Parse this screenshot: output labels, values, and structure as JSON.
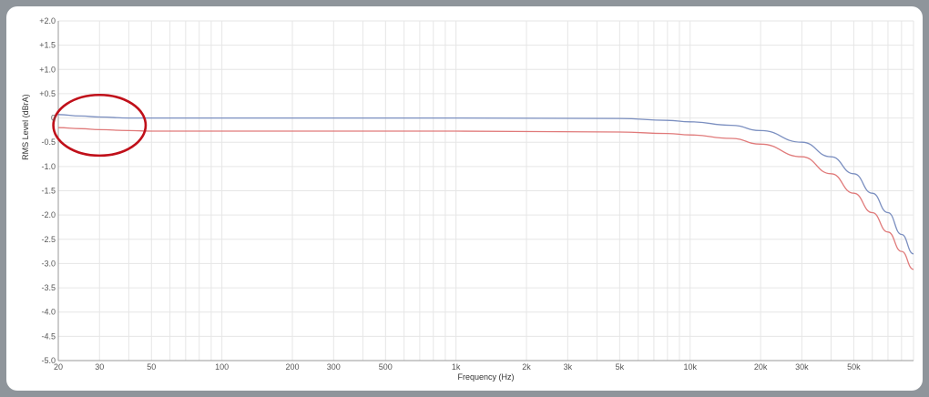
{
  "chart_data": {
    "type": "line",
    "title": "",
    "xlabel": "Frequency (Hz)",
    "ylabel": "RMS Level (dBrA)",
    "x_scale": "log",
    "xlim": [
      20,
      90000
    ],
    "ylim": [
      -5.0,
      2.0
    ],
    "grid": true,
    "legend": "none",
    "x_ticks": [
      {
        "value": 20,
        "label": "20"
      },
      {
        "value": 30,
        "label": "30"
      },
      {
        "value": 50,
        "label": "50"
      },
      {
        "value": 100,
        "label": "100"
      },
      {
        "value": 200,
        "label": "200"
      },
      {
        "value": 300,
        "label": "300"
      },
      {
        "value": 500,
        "label": "500"
      },
      {
        "value": 1000,
        "label": "1k"
      },
      {
        "value": 2000,
        "label": "2k"
      },
      {
        "value": 3000,
        "label": "3k"
      },
      {
        "value": 5000,
        "label": "5k"
      },
      {
        "value": 10000,
        "label": "10k"
      },
      {
        "value": 20000,
        "label": "20k"
      },
      {
        "value": 30000,
        "label": "30k"
      },
      {
        "value": 50000,
        "label": "50k"
      }
    ],
    "y_ticks": [
      {
        "value": 2.0,
        "label": "+2.0"
      },
      {
        "value": 1.5,
        "label": "+1.5"
      },
      {
        "value": 1.0,
        "label": "+1.0"
      },
      {
        "value": 0.5,
        "label": "+0.5"
      },
      {
        "value": 0,
        "label": "0"
      },
      {
        "value": -0.5,
        "label": "-0.5"
      },
      {
        "value": -1.0,
        "label": "-1.0"
      },
      {
        "value": -1.5,
        "label": "-1.5"
      },
      {
        "value": -2.0,
        "label": "-2.0"
      },
      {
        "value": -2.5,
        "label": "-2.5"
      },
      {
        "value": -3.0,
        "label": "-3.0"
      },
      {
        "value": -3.5,
        "label": "-3.5"
      },
      {
        "value": -4.0,
        "label": "-4.0"
      },
      {
        "value": -4.5,
        "label": "-4.5"
      },
      {
        "value": -5.0,
        "label": "-5.0"
      }
    ],
    "series": [
      {
        "color": "#7b8fc0",
        "x": [
          20,
          25,
          30,
          40,
          50,
          100,
          500,
          1000,
          5000,
          8000,
          10000,
          15000,
          20000,
          30000,
          40000,
          50000,
          60000,
          70000,
          80000,
          90000
        ],
        "y": [
          0.07,
          0.04,
          0.02,
          0.0,
          0.0,
          0.0,
          0.0,
          0.0,
          -0.01,
          -0.05,
          -0.08,
          -0.15,
          -0.26,
          -0.5,
          -0.8,
          -1.15,
          -1.55,
          -1.95,
          -2.4,
          -2.8
        ]
      },
      {
        "color": "#e07a7a",
        "x": [
          20,
          25,
          30,
          40,
          50,
          100,
          500,
          1000,
          5000,
          8000,
          10000,
          15000,
          20000,
          30000,
          40000,
          50000,
          60000,
          70000,
          80000,
          90000
        ],
        "y": [
          -0.2,
          -0.22,
          -0.24,
          -0.26,
          -0.27,
          -0.27,
          -0.27,
          -0.27,
          -0.29,
          -0.32,
          -0.35,
          -0.42,
          -0.54,
          -0.8,
          -1.15,
          -1.55,
          -1.95,
          -2.35,
          -2.75,
          -3.12
        ]
      }
    ],
    "annotation": {
      "shape": "ellipse",
      "color": "#c0101a",
      "center_x": 30,
      "center_y": -0.15,
      "x_range": [
        20,
        40
      ],
      "y_range": [
        -0.75,
        0.5
      ]
    },
    "colors": {
      "frame": "#8f959b",
      "grid": "#e6e6e6",
      "axis": "#9a9a9a"
    }
  }
}
